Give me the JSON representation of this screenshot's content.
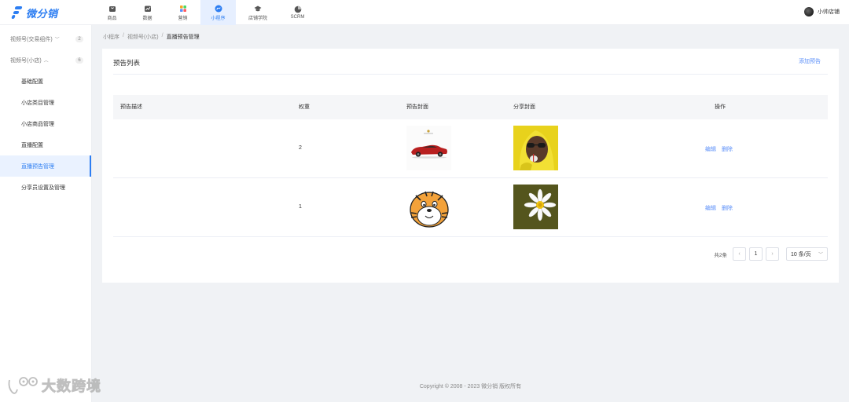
{
  "app": {
    "logo_text": "微分销"
  },
  "nav": [
    {
      "label": "商品",
      "icon": "goods-icon"
    },
    {
      "label": "数据",
      "icon": "data-icon"
    },
    {
      "label": "营销",
      "icon": "marketing-icon"
    },
    {
      "label": "小程序",
      "icon": "miniprogram-icon",
      "active": true
    },
    {
      "label": "店铺学院",
      "icon": "academy-icon"
    },
    {
      "label": "SCRM",
      "icon": "scrm-icon"
    }
  ],
  "user": {
    "name": "小帅店铺"
  },
  "sidebar": {
    "groups": [
      {
        "label": "视频号(交易组件)",
        "count": "2"
      },
      {
        "label": "视频号(小店)",
        "count": "6"
      }
    ],
    "items": [
      {
        "label": "基础配置"
      },
      {
        "label": "小店类目管理"
      },
      {
        "label": "小店商品管理"
      },
      {
        "label": "直播配置"
      },
      {
        "label": "直播预告管理",
        "active": true
      },
      {
        "label": "分享员设置及管理"
      }
    ]
  },
  "breadcrumb": [
    "小程序",
    "视频号(小店)",
    "直播预告管理"
  ],
  "card": {
    "title": "预告列表",
    "add_label": "添加预告"
  },
  "table": {
    "columns": [
      "预告描述",
      "权重",
      "预告封面",
      "分享封面",
      "操作"
    ],
    "rows": [
      {
        "description": "",
        "weight": "2",
        "cover": "red-sports-car",
        "share_cover": "person-yellow-hood",
        "edit": "编辑",
        "delete": "删除"
      },
      {
        "description": "",
        "weight": "1",
        "cover": "cartoon-tiger",
        "share_cover": "daisy-flower",
        "edit": "编辑",
        "delete": "删除"
      }
    ]
  },
  "pagination": {
    "total": "共2条",
    "current_page": "1",
    "page_size": "10 条/页"
  },
  "footer": {
    "copyright": "Copyright © 2008 - 2023 微分销 版权所有"
  },
  "watermark": {
    "text": "大数跨境"
  },
  "colors": {
    "accent": "#2d7ef2",
    "link": "#5b8ff9",
    "bg": "#f0f2f5"
  }
}
